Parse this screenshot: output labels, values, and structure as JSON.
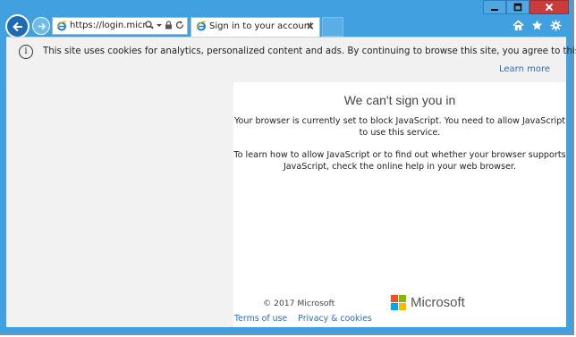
{
  "browser": {
    "address_url": "https://login.micr...",
    "tab_title": "Sign in to your account"
  },
  "icons": {
    "back": "back-arrow-icon",
    "forward": "forward-arrow-icon",
    "ie": "ie-logo-icon",
    "search": "search-icon",
    "lock": "lock-icon",
    "refresh": "refresh-icon",
    "home": "home-icon",
    "favorites": "star-icon",
    "settings": "gear-icon"
  },
  "cookie_notice": {
    "message": "This site uses cookies for analytics, personalized content and ads. By continuing to browse this site, you agree to this use.",
    "learn_more": "Learn more"
  },
  "main": {
    "heading": "We can't sign you in",
    "paragraph1": "Your browser is currently set to block JavaScript. You need to allow JavaScript to use this service.",
    "paragraph2": "To learn how to allow JavaScript or to find out whether your browser supports JavaScript, check the online help in your web browser."
  },
  "footer": {
    "copyright": "© 2017 Microsoft",
    "brand": "Microsoft",
    "terms": "Terms of use",
    "privacy": "Privacy & cookies"
  },
  "colors": {
    "frame": "#41a0e0",
    "link": "#2b6fb6",
    "ms_red": "#f25022",
    "ms_green": "#7fba00",
    "ms_blue": "#00a4ef",
    "ms_yellow": "#ffb900"
  }
}
